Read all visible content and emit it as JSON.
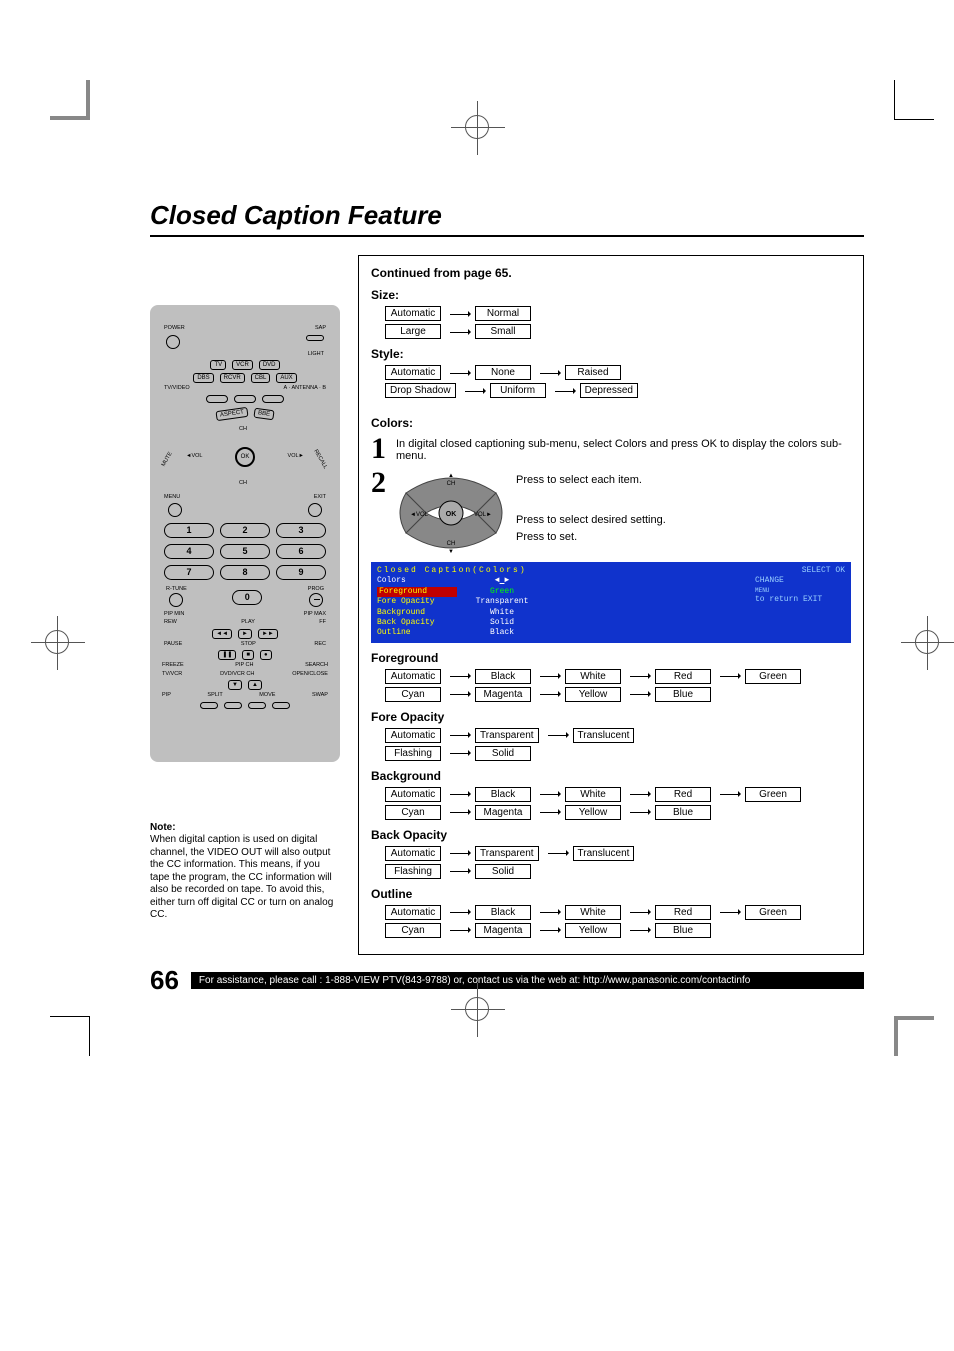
{
  "page_title": "Closed Caption Feature",
  "continued": "Continued from page 65.",
  "size_heading": "Size:",
  "size_options": [
    "Automatic",
    "Normal",
    "Large",
    "Small"
  ],
  "style_heading": "Style:",
  "style_options": [
    "Automatic",
    "None",
    "Raised",
    "Drop Shadow",
    "Uniform",
    "Depressed"
  ],
  "colors_heading": "Colors:",
  "step1_num": "1",
  "step1_text": "In digital closed captioning sub-menu, select Colors and press OK to display the colors sub-menu.",
  "step2_num": "2",
  "step2_line1": "Press to select each item.",
  "step2_line2": "Press to select desired setting.",
  "step2_line3": "Press to set.",
  "nav_labels": {
    "ch": "CH",
    "vol": "VOL",
    "ok": "OK"
  },
  "osd": {
    "title": "Closed  Caption(Colors)",
    "right_top": "SELECT    OK",
    "right_mid": "CHANGE",
    "right_menu": "MENU",
    "right_exit": "to return   EXIT",
    "rows": [
      {
        "k": "Colors",
        "v": ""
      },
      {
        "k": "Foreground",
        "v": "Green",
        "sel": true
      },
      {
        "k": "Fore Opacity",
        "v": "Transparent"
      },
      {
        "k": "Background",
        "v": "White"
      },
      {
        "k": "Back Opacity",
        "v": "Solid"
      },
      {
        "k": "Outline",
        "v": "Black"
      }
    ]
  },
  "foreground_heading": "Foreground",
  "color_options_row1": [
    "Automatic",
    "Black",
    "White",
    "Red",
    "Green"
  ],
  "color_options_row2": [
    "Cyan",
    "Magenta",
    "Yellow",
    "Blue"
  ],
  "fore_opacity_heading": "Fore Opacity",
  "opacity_row1": [
    "Automatic",
    "Transparent",
    "Translucent"
  ],
  "opacity_row2": [
    "Flashing",
    "Solid"
  ],
  "background_heading": "Background",
  "back_opacity_heading": "Back Opacity",
  "outline_heading": "Outline",
  "note_heading": "Note:",
  "note_body": "When digital caption is used on digital channel, the VIDEO OUT will also output the CC information. This means, if you tape the program, the CC information will also be recorded on tape. To avoid this, either turn off digital CC or turn on analog CC.",
  "page_number": "66",
  "footer_text": "For assistance, please call : 1-888-VIEW PTV(843-9788) or, contact us via the web at: http://www.panasonic.com/contactinfo",
  "remote": {
    "power": "POWER",
    "sap": "SAP",
    "light": "LIGHT",
    "row_src": [
      "TV",
      "VCR",
      "DVD"
    ],
    "row_src2": [
      "DBS",
      "RCVR",
      "CBL",
      "AUX"
    ],
    "tvvideo": "TV/VIDEO",
    "ant": "A · ANTENNA · B",
    "aspect": "ASPECT",
    "bbe": "BBE",
    "mute": "MUTE",
    "recall": "RECALL",
    "ch": "CH",
    "vol": "VOL",
    "ok": "OK",
    "menu": "MENU",
    "exit": "EXIT",
    "nums": [
      "1",
      "2",
      "3",
      "4",
      "5",
      "6",
      "7",
      "8",
      "9"
    ],
    "zero": "0",
    "rtune": "R-TUNE",
    "prog": "PROG",
    "pipmin": "PIP MIN",
    "pipmax": "PIP MAX",
    "rew": "REW",
    "play": "PLAY",
    "ff": "FF",
    "pause": "PAUSE",
    "stop": "STOP",
    "rec": "REC",
    "freeze": "FREEZE",
    "tvvcr": "TV/VCR",
    "pipch": "PIP CH",
    "dvdvcrch": "DVD/VCR CH",
    "search": "SEARCH",
    "openclose": "OPEN/CLOSE",
    "pip": "PIP",
    "split": "SPLIT",
    "move": "MOVE",
    "swap": "SWAP"
  }
}
